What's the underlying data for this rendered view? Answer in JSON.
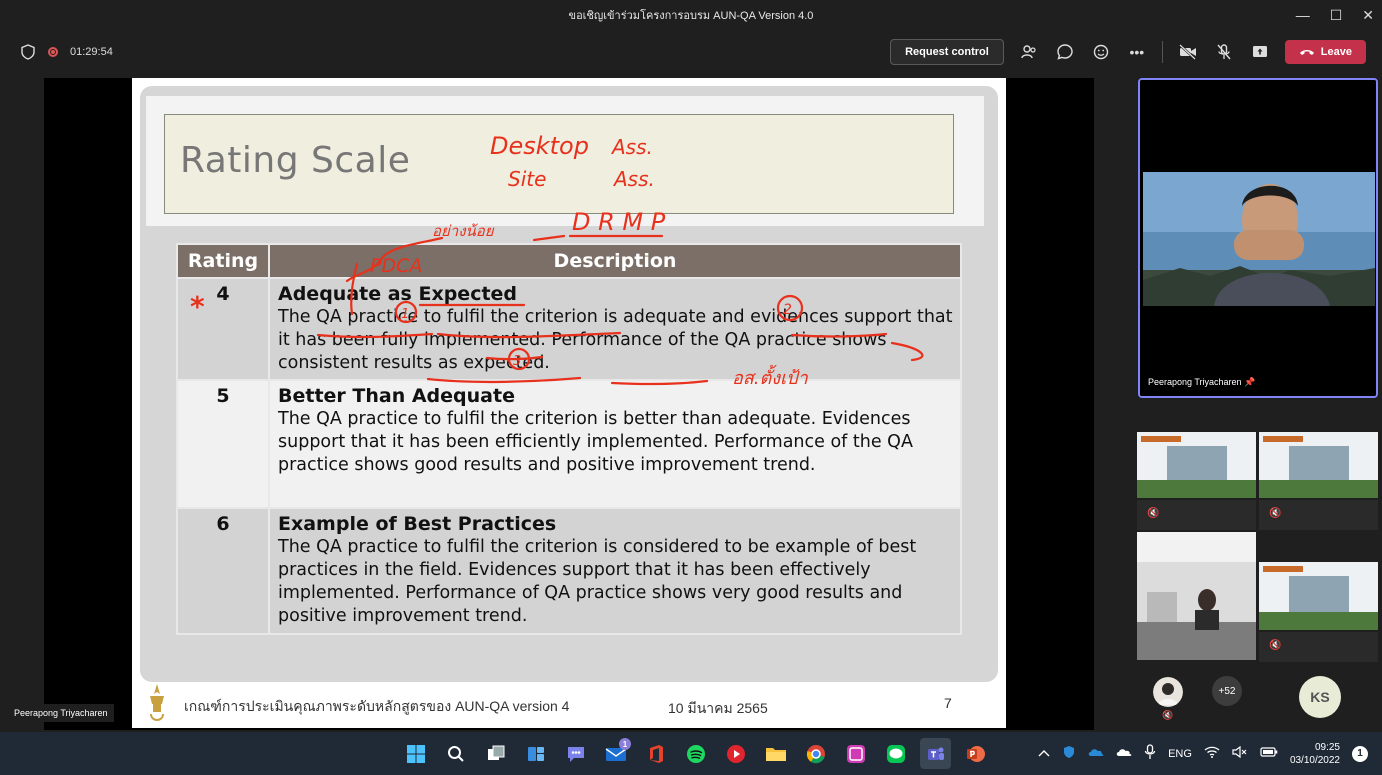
{
  "window": {
    "title": "ขอเชิญเข้าร่วมโครงการอบรม AUN-QA Version 4.0",
    "minimize_glyph": "—",
    "maximize_glyph": "☐",
    "close_glyph": "✕"
  },
  "toolbar": {
    "timer": "01:29:54",
    "request_control_label": "Request control",
    "leave_label": "Leave",
    "more_glyph": "•••"
  },
  "slide": {
    "title": "Rating Scale",
    "table_headers": {
      "rating": "Rating",
      "description": "Description"
    },
    "rows": [
      {
        "rating": "4",
        "heading": "Adequate as Expected",
        "body": "The QA practice to fulfil the criterion is adequate and evidences support that it has been fully implemented. Performance of the QA practice shows consistent results as expected."
      },
      {
        "rating": "5",
        "heading": "Better Than Adequate",
        "body": "The QA practice to fulfil the criterion is better than adequate. Evidences support that it has been efficiently implemented. Performance of the QA practice shows good results and positive improvement trend."
      },
      {
        "rating": "6",
        "heading": "Example of Best Practices",
        "body": "The QA practice to fulfil the criterion is considered to be example of best practices in the field. Evidences support that it has been effectively implemented. Performance of QA practice shows very good results and positive improvement trend."
      }
    ],
    "footer_text": "เกณฑ์การประเมินคุณภาพระดับหลักสูตรของ AUN-QA version 4",
    "footer_date": "10 มีนาคม 2565",
    "page_number": "7"
  },
  "annotations": {
    "desktop": "Desktop",
    "site": "Site",
    "ass_1": "Ass.",
    "ass_2": "Ass.",
    "drmp": "D R M P",
    "pdca": "PDCA",
    "thai_note_top": "อย่างน้อย",
    "thai_note_bottom": "อส.ตั้งเป้า",
    "circle_1": "1",
    "circle_2": "2",
    "circle_3": "3",
    "star": "*",
    "ink_color": "#e8311c"
  },
  "presenter": {
    "name": "Peerapong Triyacharen",
    "pin_glyph": "📌"
  },
  "participants": {
    "more_count": "+52",
    "ks_initials": "KS"
  },
  "taskbar": {
    "language": "ENG",
    "time": "09:25",
    "date": "03/10/2022",
    "notifications": "1",
    "teams_badge": "1"
  }
}
